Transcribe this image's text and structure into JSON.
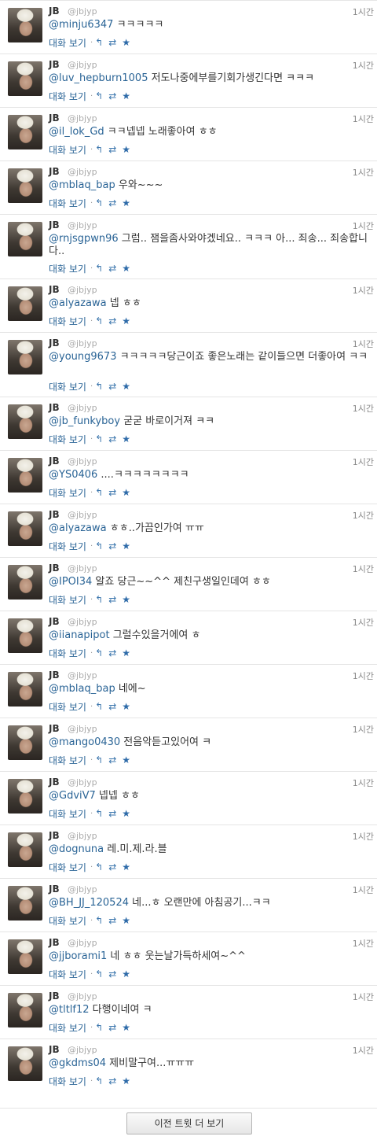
{
  "tweets": [
    {
      "name": "JB",
      "handle": "@jbjyp",
      "time": "1시간",
      "mention": "@minju6347",
      "text": " ㅋㅋㅋㅋㅋ",
      "convo": "대화 보기"
    },
    {
      "name": "JB",
      "handle": "@jbjyp",
      "time": "1시간",
      "mention": "@luv_hepburn1005",
      "text": " 저도나중에부를기회가생긴다면 ㅋㅋㅋ",
      "convo": "대화 보기"
    },
    {
      "name": "JB",
      "handle": "@jbjyp",
      "time": "1시간",
      "mention": "@il_lok_Gd",
      "text": " ㅋㅋ넵넵 노래좋아여 ㅎㅎ",
      "convo": "대화 보기"
    },
    {
      "name": "JB",
      "handle": "@jbjyp",
      "time": "1시간",
      "mention": "@mblaq_bap",
      "text": " 우와~~~",
      "convo": "대화 보기"
    },
    {
      "name": "JB",
      "handle": "@jbjyp",
      "time": "1시간",
      "mention": "@rnjsgpwn96",
      "text": " 그럼.. 잼을좀사와야겠네요.. ㅋㅋㅋ 아... 죄송... 죄송합니다..",
      "convo": "대화 보기"
    },
    {
      "name": "JB",
      "handle": "@jbjyp",
      "time": "1시간",
      "mention": "@alyazawa",
      "text": " 넵 ㅎㅎ",
      "convo": "대화 보기"
    },
    {
      "name": "JB",
      "handle": "@jbjyp",
      "time": "1시간",
      "mention": "@young9673",
      "text": " ㅋㅋㅋㅋㅋ당근이죠 좋은노래는 같이들으면 더좋아여 ㅋㅋ",
      "convo": "대화 보기"
    },
    {
      "name": "JB",
      "handle": "@jbjyp",
      "time": "1시간",
      "mention": "@jb_funkyboy",
      "text": " 굳굳 바로이거져 ㅋㅋ",
      "convo": "대화 보기"
    },
    {
      "name": "JB",
      "handle": "@jbjyp",
      "time": "1시간",
      "mention": "@YS0406",
      "text": " ....ㅋㅋㅋㅋㅋㅋㅋㅋ",
      "convo": "대화 보기"
    },
    {
      "name": "JB",
      "handle": "@jbjyp",
      "time": "1시간",
      "mention": "@alyazawa",
      "text": " ㅎㅎ..가끔인가여 ㅠㅠ",
      "convo": "대화 보기"
    },
    {
      "name": "JB",
      "handle": "@jbjyp",
      "time": "1시간",
      "mention": "@IPOI34",
      "text": " 알죠 당근~~^^ 제친구생일인데여 ㅎㅎ",
      "convo": "대화 보기"
    },
    {
      "name": "JB",
      "handle": "@jbjyp",
      "time": "1시간",
      "mention": "@iianapipot",
      "text": " 그럴수있을거에여 ㅎ",
      "convo": "대화 보기"
    },
    {
      "name": "JB",
      "handle": "@jbjyp",
      "time": "1시간",
      "mention": "@mblaq_bap",
      "text": " 네에~",
      "convo": "대화 보기"
    },
    {
      "name": "JB",
      "handle": "@jbjyp",
      "time": "1시간",
      "mention": "@mango0430",
      "text": " 전음악듣고있어여 ㅋ",
      "convo": "대화 보기"
    },
    {
      "name": "JB",
      "handle": "@jbjyp",
      "time": "1시간",
      "mention": "@GdviV7",
      "text": " 넵넵 ㅎㅎ",
      "convo": "대화 보기"
    },
    {
      "name": "JB",
      "handle": "@jbjyp",
      "time": "1시간",
      "mention": "@dognuna",
      "text": " 레.미.제.라.블",
      "convo": "대화 보기"
    },
    {
      "name": "JB",
      "handle": "@jbjyp",
      "time": "1시간",
      "mention": "@BH_JJ_120524",
      "text": " 네...ㅎ 오랜만에 아침공기...ㅋㅋ",
      "convo": "대화 보기"
    },
    {
      "name": "JB",
      "handle": "@jbjyp",
      "time": "1시간",
      "mention": "@jjborami1",
      "text": " 네 ㅎㅎ 웃는날가득하세여~^^",
      "convo": "대화 보기"
    },
    {
      "name": "JB",
      "handle": "@jbjyp",
      "time": "1시간",
      "mention": "@tltlf12",
      "text": " 다행이네여 ㅋ",
      "convo": "대화 보기"
    },
    {
      "name": "JB",
      "handle": "@jbjyp",
      "time": "1시간",
      "mention": "@gkdms04",
      "text": " 제비말구여...ㅠㅠㅠ",
      "convo": "대화 보기"
    }
  ],
  "icons": {
    "reply": "reply-arrow-icon",
    "retweet": "retweet-icon",
    "favorite": "star-icon"
  },
  "load_more": {
    "label": "이전 트윗 더 보기"
  },
  "colors": {
    "link": "#2a6496",
    "action_icon": "#3b76ad",
    "divider": "#e5e5e5"
  }
}
